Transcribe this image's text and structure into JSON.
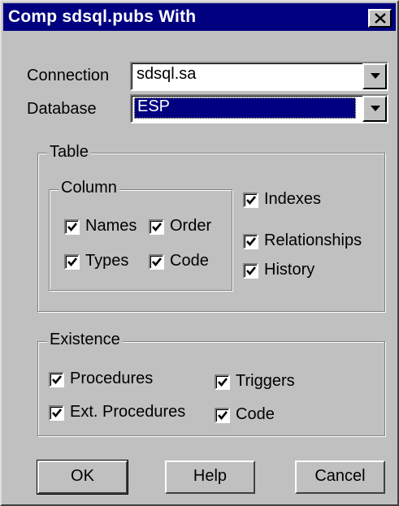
{
  "window": {
    "title": "Comp sdsql.pubs With"
  },
  "connection": {
    "label": "Connection",
    "value": "sdsql.sa"
  },
  "database": {
    "label": "Database",
    "value": "ESP"
  },
  "table_group": {
    "title": "Table",
    "column_group": {
      "title": "Column",
      "names": {
        "label": "Names",
        "checked": true
      },
      "order": {
        "label": "Order",
        "checked": true
      },
      "types": {
        "label": "Types",
        "checked": true
      },
      "code": {
        "label": "Code",
        "checked": true
      }
    },
    "indexes": {
      "label": "Indexes",
      "checked": true
    },
    "relationships": {
      "label": "Relationships",
      "checked": true
    },
    "history": {
      "label": "History",
      "checked": true
    }
  },
  "existence_group": {
    "title": "Existence",
    "procedures": {
      "label": "Procedures",
      "checked": true
    },
    "ext_procedures": {
      "label": "Ext. Procedures",
      "checked": true
    },
    "triggers": {
      "label": "Triggers",
      "checked": true
    },
    "code": {
      "label": "Code",
      "checked": true
    }
  },
  "buttons": {
    "ok": "OK",
    "help": "Help",
    "cancel": "Cancel"
  },
  "icons": {
    "close": "close-icon",
    "dropdown": "chevron-down-icon",
    "check": "checkmark-icon"
  },
  "colors": {
    "titlebar": "#000080",
    "face": "#c0c0c0",
    "selection": "#000080"
  }
}
